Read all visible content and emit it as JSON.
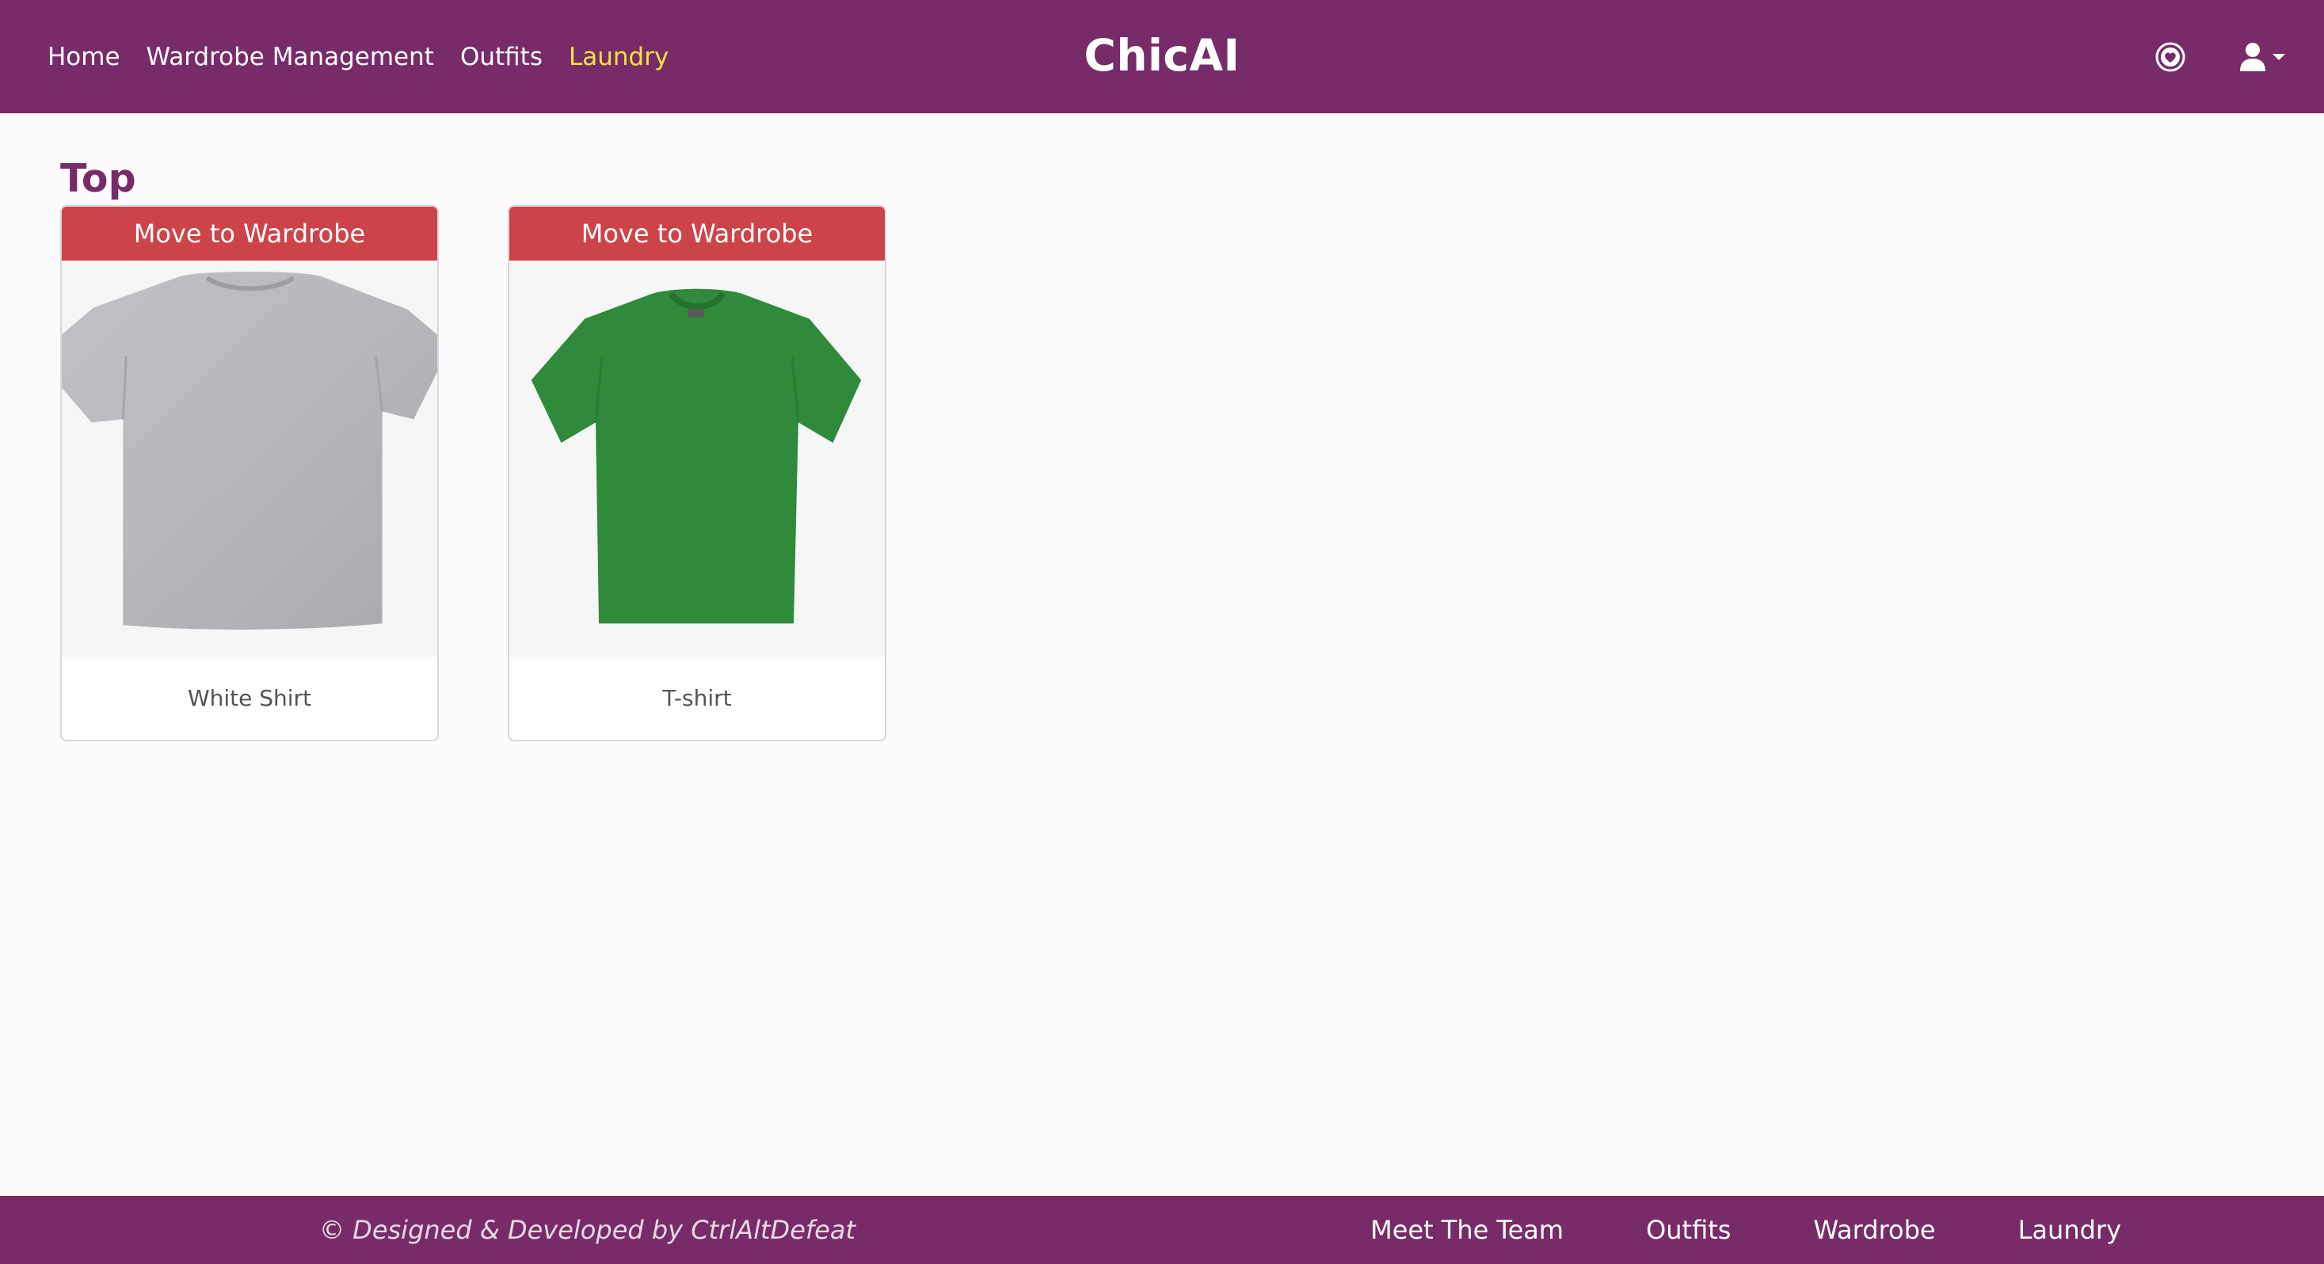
{
  "nav": {
    "links": [
      {
        "label": "Home",
        "active": false
      },
      {
        "label": "Wardrobe Management",
        "active": false
      },
      {
        "label": "Outfits",
        "active": false
      },
      {
        "label": "Laundry",
        "active": true
      }
    ],
    "brand": "ChicAI",
    "icons": {
      "favorites": "heart-circle-icon",
      "account": "user-icon"
    }
  },
  "main": {
    "section_title": "Top",
    "items": [
      {
        "button_label": "Move to Wardrobe",
        "name": "White Shirt",
        "image": "gray-tshirt",
        "color": "#b9b9bd"
      },
      {
        "button_label": "Move to Wardrobe",
        "name": "T-shirt",
        "image": "green-tshirt",
        "color": "#2f8a3c"
      }
    ]
  },
  "footer": {
    "credit": "© Designed & Developed by CtrlAltDefeat",
    "links": [
      "Meet The Team",
      "Outfits",
      "Wardrobe",
      "Laundry"
    ]
  },
  "colors": {
    "brand_purple": "#772c69",
    "active_nav": "#f6e23f",
    "button_red": "#cc4449"
  }
}
